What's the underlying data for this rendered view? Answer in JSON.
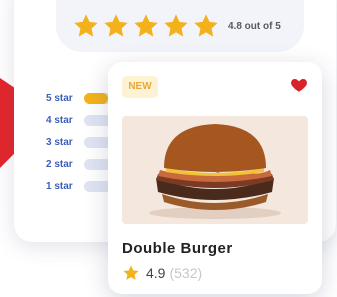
{
  "summary": {
    "rating_text": "4.8 out of 5",
    "stars_filled": 5
  },
  "distribution": [
    {
      "label": "5 star",
      "fraction": 0.55
    },
    {
      "label": "4 star",
      "fraction": 0.0
    },
    {
      "label": "3 star",
      "fraction": 0.0
    },
    {
      "label": "2 star",
      "fraction": 0.0
    },
    {
      "label": "1 star",
      "fraction": 0.0
    }
  ],
  "product": {
    "badge": "NEW",
    "name": "Double Burger",
    "rating": "4.9",
    "reviews": "(532)",
    "image_icon": "burger-image",
    "favorite_icon": "heart-icon"
  },
  "colors": {
    "accent": "#f3b21d",
    "brand_red": "#e3262c",
    "label_blue": "#3d5fb8"
  }
}
